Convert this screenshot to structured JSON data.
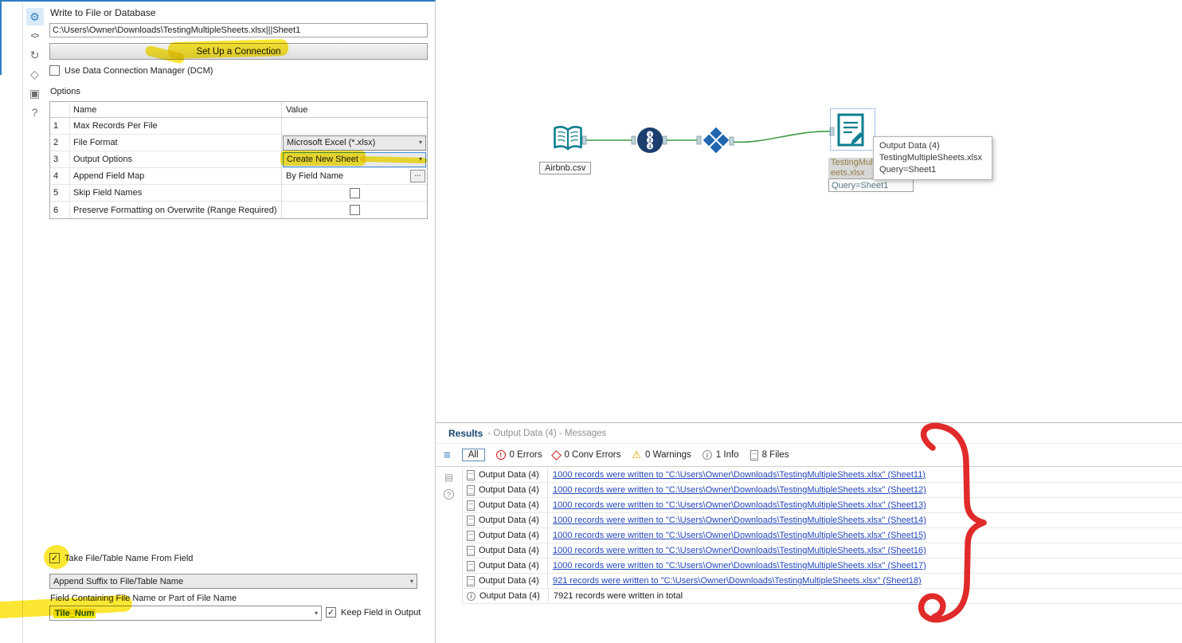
{
  "config": {
    "title": "Write to File or Database",
    "path_value": "C:\\Users\\Owner\\Downloads\\TestingMultipleSheets.xlsx|||Sheet1",
    "setup_button_label": "Set Up a Connection",
    "dcm_checkbox_label": "Use Data Connection Manager (DCM)",
    "options_label": "Options",
    "table": {
      "headers": {
        "name": "Name",
        "value": "Value"
      },
      "rows": [
        {
          "num": "1",
          "name": "Max Records Per File",
          "value": ""
        },
        {
          "num": "2",
          "name": "File Format",
          "value": "Microsoft Excel (*.xlsx)"
        },
        {
          "num": "3",
          "name": "Output Options",
          "value": "Create New Sheet"
        },
        {
          "num": "4",
          "name": "Append Field Map",
          "value": "By Field Name",
          "ellipsis": "..."
        },
        {
          "num": "5",
          "name": "Skip Field Names",
          "value": ""
        },
        {
          "num": "6",
          "name": "Preserve Formatting on Overwrite (Range Required)",
          "value": ""
        }
      ]
    },
    "take_name_label": "Take File/Table Name From Field",
    "suffix_value": "Append Suffix to File/Table Name",
    "field_label": "Field Containing File Name or Part of File Name",
    "field_value": "Tile_Num",
    "keep_field_label": "Keep Field in Output"
  },
  "canvas": {
    "input_tool_label": "Airbnb.csv",
    "tile_numbers": [
      "1",
      "2",
      "3"
    ],
    "output_annotation_line1": "TestingMultipleSh",
    "output_annotation_line2": "eets.xlsx",
    "output_query_label": "Query=Sheet1",
    "tooltip": {
      "title": "Output Data (4)",
      "file": "TestingMultipleSheets.xlsx",
      "query": "Query=Sheet1"
    }
  },
  "results": {
    "title": "Results",
    "subtitle": "- Output Data (4) - Messages",
    "filters": {
      "all": "All",
      "errors": "0 Errors",
      "conv_errors": "0 Conv Errors",
      "warnings": "0 Warnings",
      "info": "1 Info",
      "files": "8 Files"
    },
    "messages": [
      {
        "source": "Output Data (4)",
        "text": "1000 records were written to \"C:\\Users\\Owner\\Downloads\\TestingMultipleSheets.xlsx\" (Sheet11)"
      },
      {
        "source": "Output Data (4)",
        "text": "1000 records were written to \"C:\\Users\\Owner\\Downloads\\TestingMultipleSheets.xlsx\" (Sheet12)"
      },
      {
        "source": "Output Data (4)",
        "text": "1000 records were written to \"C:\\Users\\Owner\\Downloads\\TestingMultipleSheets.xlsx\" (Sheet13)"
      },
      {
        "source": "Output Data (4)",
        "text": "1000 records were written to \"C:\\Users\\Owner\\Downloads\\TestingMultipleSheets.xlsx\" (Sheet14)"
      },
      {
        "source": "Output Data (4)",
        "text": "1000 records were written to \"C:\\Users\\Owner\\Downloads\\TestingMultipleSheets.xlsx\" (Sheet15)"
      },
      {
        "source": "Output Data (4)",
        "text": "1000 records were written to \"C:\\Users\\Owner\\Downloads\\TestingMultipleSheets.xlsx\" (Sheet16)"
      },
      {
        "source": "Output Data (4)",
        "text": "1000 records were written to \"C:\\Users\\Owner\\Downloads\\TestingMultipleSheets.xlsx\" (Sheet17)"
      },
      {
        "source": "Output Data (4)",
        "text": "921 records were written to \"C:\\Users\\Owner\\Downloads\\TestingMultipleSheets.xlsx\" (Sheet18)"
      },
      {
        "source": "Output Data (4)",
        "text": "7921 records were written in total"
      }
    ]
  },
  "icons": {
    "gear": "⚙",
    "code": "<>",
    "refresh": "↻",
    "tag": "◇",
    "package": "▣",
    "help": "?",
    "menu": "≡",
    "chevron_down": "▾",
    "error_mark": "!",
    "warning": "⚠",
    "info_mark": "i",
    "question": "?",
    "table": "▤"
  },
  "colors": {
    "accent_blue": "#2e7fc2",
    "teal": "#0b7e90",
    "navy": "#1c3e6e",
    "tool_blue": "#2166b0",
    "connector_green": "#3f9b45",
    "link_blue": "#2346bb",
    "highlight_yellow": "#f0e70c",
    "annotation_red": "#df1a1a"
  }
}
